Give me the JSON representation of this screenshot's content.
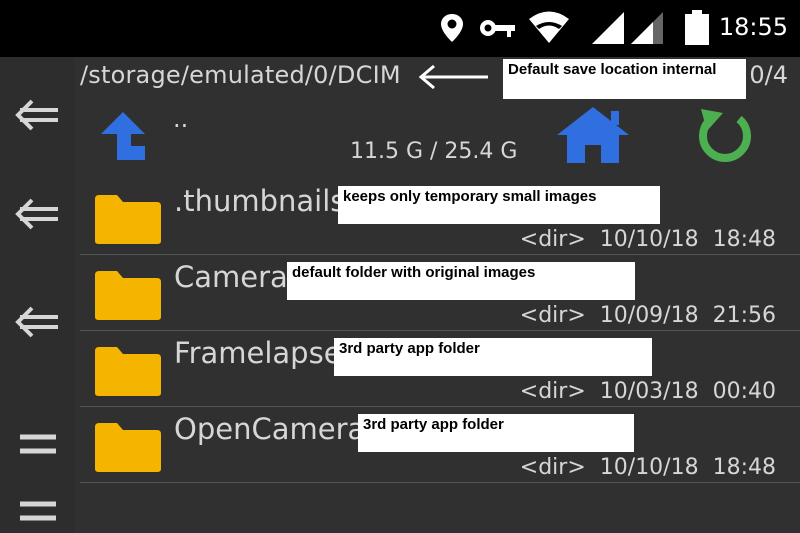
{
  "statusbar": {
    "time": "18:55",
    "icons": [
      "location-icon",
      "vpn-key-icon",
      "wifi-icon",
      "cell-signal-icon",
      "cell-signal-2-icon",
      "battery-icon"
    ]
  },
  "sidebar": {
    "buttons": [
      "back-arrow-icon",
      "back-arrow-icon",
      "back-arrow-icon",
      "menu-icon",
      "menu-icon"
    ]
  },
  "header": {
    "path": "/storage/emulated/0/DCIM",
    "page_count": "0/4",
    "up_label": "..",
    "storage": "11.5 G / 25.4 G",
    "annotation": "Default save location internal"
  },
  "colors": {
    "up": "#2f6fe0",
    "home": "#2f6fe0",
    "refresh": "#4caf50",
    "folder": "#f5b400"
  },
  "folders": [
    {
      "name": ".thumbnails",
      "type": "<dir>",
      "date": "10/10/18",
      "time": "18:48",
      "annotation": "keeps only temporary small images"
    },
    {
      "name": "Camera",
      "type": "<dir>",
      "date": "10/09/18",
      "time": "21:56",
      "annotation": "default folder with original images"
    },
    {
      "name": "Framelapse",
      "type": "<dir>",
      "date": "10/03/18",
      "time": "00:40",
      "annotation": "3rd party app folder"
    },
    {
      "name": "OpenCamera",
      "type": "<dir>",
      "date": "10/10/18",
      "time": "18:48",
      "annotation": "3rd party app folder"
    }
  ]
}
